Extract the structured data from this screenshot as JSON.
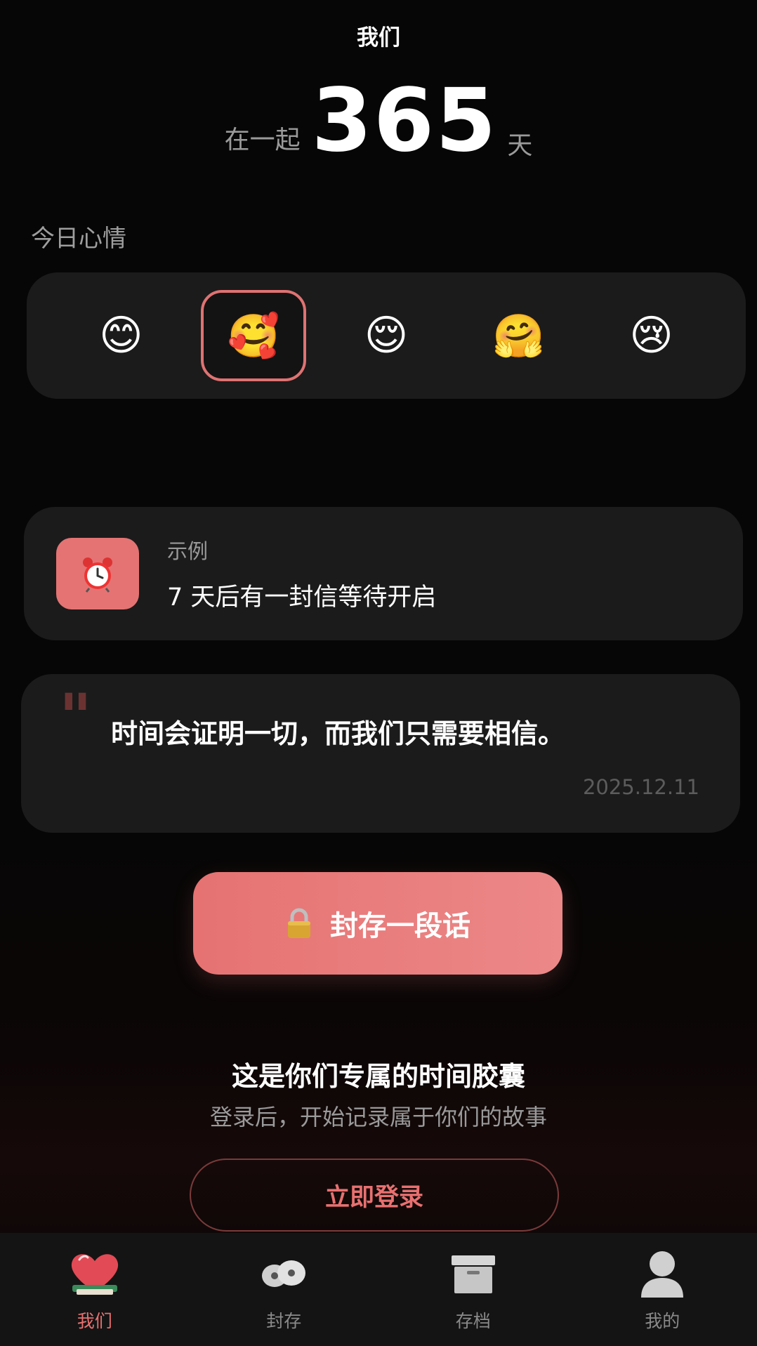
{
  "header": {
    "title": "我们"
  },
  "counter": {
    "prefix": "在一起",
    "days": "365",
    "suffix": "天"
  },
  "mood": {
    "label": "今日心情",
    "items": [
      {
        "emoji": "😊",
        "selected": false
      },
      {
        "emoji": "🥰",
        "selected": true
      },
      {
        "emoji": "😌",
        "selected": false
      },
      {
        "emoji": "🤗",
        "selected": false
      },
      {
        "emoji": "😢",
        "selected": false
      }
    ]
  },
  "reminder": {
    "icon": "alarm-clock-icon",
    "tag": "示例",
    "message": "7 天后有一封信等待开启"
  },
  "quote": {
    "mark": "\"",
    "text": "时间会证明一切，而我们只需要相信。",
    "date": "2025.12.11"
  },
  "seal_button": {
    "icon": "lock-icon",
    "label": "封存一段话"
  },
  "promo": {
    "title": "这是你们专属的时间胶囊",
    "subtitle": "登录后，开始记录属于你们的故事",
    "login_label": "立即登录"
  },
  "tabbar": {
    "tabs": [
      {
        "label": "我们",
        "icon": "heart-icon",
        "active": true
      },
      {
        "label": "封存",
        "icon": "sealed-icon",
        "active": false
      },
      {
        "label": "存档",
        "icon": "archive-box-icon",
        "active": false
      },
      {
        "label": "我的",
        "icon": "person-icon",
        "active": false
      }
    ]
  },
  "colors": {
    "background": "#000000",
    "card": "#1b1b1b",
    "accent": "#e57373",
    "tab_inactive": "#8a8a8a"
  }
}
